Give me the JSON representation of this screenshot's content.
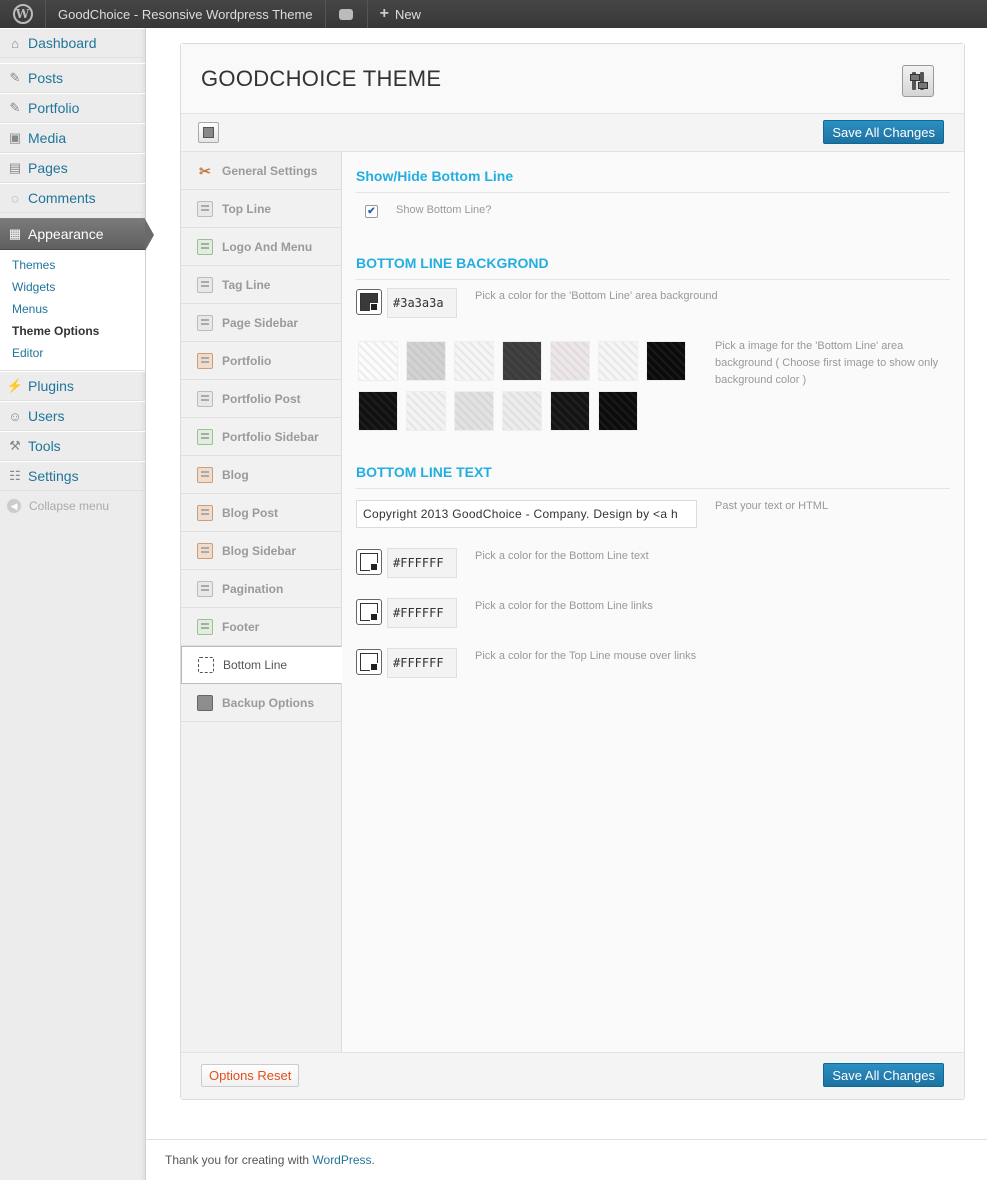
{
  "adminbar": {
    "site_name": "GoodChoice - Resonsive Wordpress Theme",
    "new_label": "New"
  },
  "menu": {
    "items_top": [
      {
        "label": "Dashboard",
        "icon": "dashboard-icon"
      }
    ],
    "items_main": [
      {
        "label": "Posts",
        "icon": "pin-icon"
      },
      {
        "label": "Portfolio",
        "icon": "pin-icon"
      },
      {
        "label": "Media",
        "icon": "media-icon"
      },
      {
        "label": "Pages",
        "icon": "pages-icon"
      },
      {
        "label": "Comments",
        "icon": "comment-icon"
      }
    ],
    "current": {
      "label": "Appearance",
      "icon": "appearance-icon"
    },
    "submenu": [
      "Themes",
      "Widgets",
      "Menus",
      "Theme Options",
      "Editor"
    ],
    "items_after": [
      {
        "label": "Plugins",
        "icon": "plugin-icon"
      },
      {
        "label": "Users",
        "icon": "users-icon"
      },
      {
        "label": "Tools",
        "icon": "tools-icon"
      },
      {
        "label": "Settings",
        "icon": "settings-icon"
      }
    ],
    "collapse_label": "Collapse menu"
  },
  "panel": {
    "title": "GOODCHOICE THEME",
    "save_label": "Save All Changes",
    "reset_label": "Options Reset",
    "tabs": [
      "General Settings",
      "Top Line",
      "Logo And Menu",
      "Tag Line",
      "Page Sidebar",
      "Portfolio",
      "Portfolio Post",
      "Portfolio Sidebar",
      "Blog",
      "Blog Post",
      "Blog Sidebar",
      "Pagination",
      "Footer",
      "Bottom Line",
      "Backup Options"
    ],
    "active_tab": "Bottom Line"
  },
  "content": {
    "section1": {
      "title": "Show/Hide Bottom Line",
      "checkbox_label": "Show Bottom Line?",
      "checked": true
    },
    "section2": {
      "title": "BOTTOM LINE BACKGROND",
      "color_value": "#3a3a3a",
      "color_desc": "Pick a color for the 'Bottom Line' area background",
      "pattern_desc": "Pick a image for the 'Bottom Line' area background ( Choose first image to show only background color )",
      "patterns": [
        "#fbfbfb",
        "#d2d2d2",
        "#f5f5f5",
        "#3c3c3c",
        "#ece6e8",
        "#f6f6f6",
        "#0b0b0b",
        "#111111",
        "#f3f3f3",
        "#e2e2e2",
        "#ececec",
        "#141414",
        "#0c0c0c"
      ]
    },
    "section3": {
      "title": "BOTTOM LINE TEXT",
      "text_value": "Copyright 2013 GoodChoice - Company. Design by <a h",
      "text_desc": "Past your text or HTML",
      "colors": [
        {
          "value": "#FFFFFF",
          "desc": "Pick a color for the Bottom Line text"
        },
        {
          "value": "#FFFFFF",
          "desc": "Pick a color for the Bottom Line links"
        },
        {
          "value": "#FFFFFF",
          "desc": "Pick a color for the Top Line mouse over links"
        }
      ]
    }
  },
  "footer": {
    "text": "Thank you for creating with ",
    "link": "WordPress",
    "suffix": "."
  },
  "colors": {
    "accent": "#21759b",
    "section_title": "#24aee0",
    "button": "#2a8fc1"
  }
}
